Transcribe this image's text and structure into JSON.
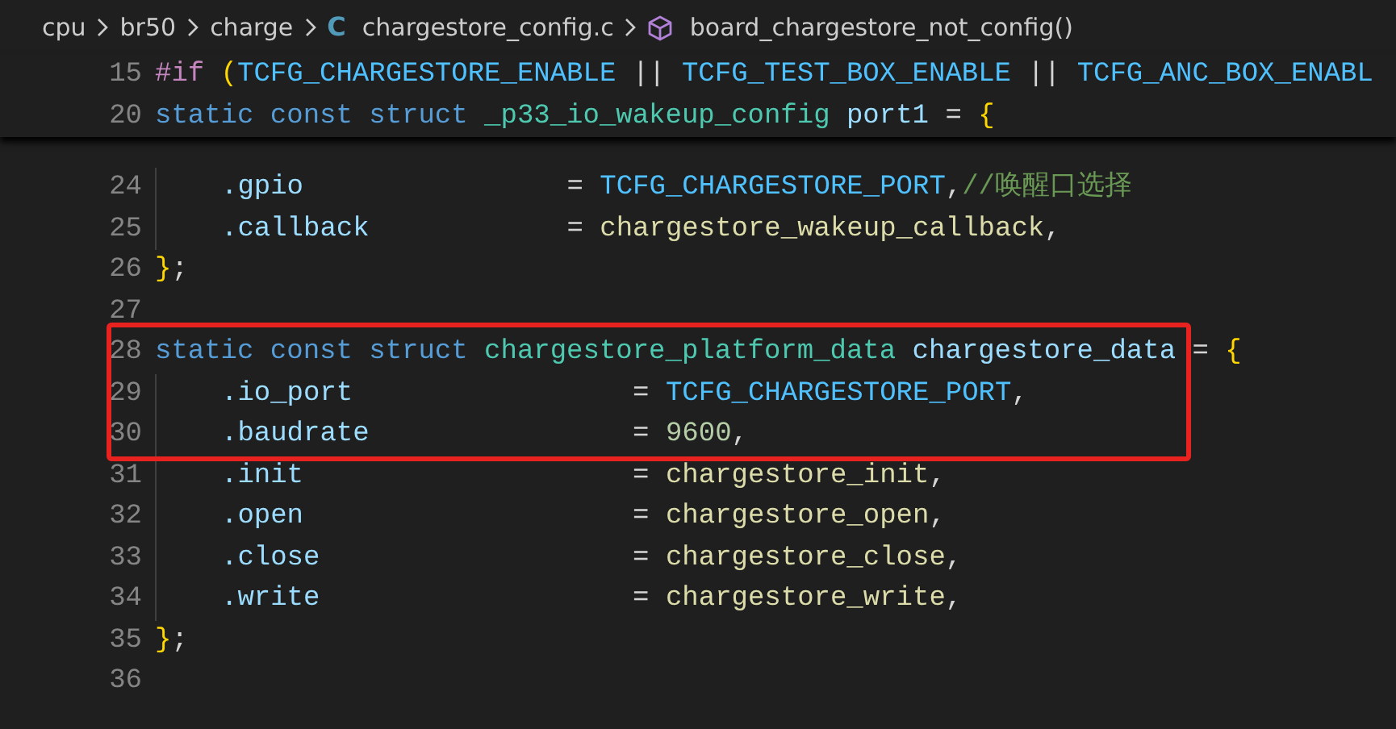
{
  "breadcrumb": [
    {
      "text": "cpu",
      "kind": "folder"
    },
    {
      "text": "br50",
      "kind": "folder"
    },
    {
      "text": "charge",
      "kind": "folder"
    },
    {
      "text": "chargestore_config.c",
      "kind": "file",
      "icon_text": "C"
    },
    {
      "text": "board_chargestore_not_config()",
      "kind": "symbol"
    }
  ],
  "sticky_lines": [
    {
      "number": "15",
      "guide": false,
      "tokens": [
        {
          "t": "#if",
          "kind": "directive"
        },
        {
          "t": " (",
          "kind": "brace"
        },
        {
          "t": "TCFG_CHARGESTORE_ENABLE",
          "kind": "macro"
        },
        {
          "t": " || ",
          "kind": "plain"
        },
        {
          "t": "TCFG_TEST_BOX_ENABLE",
          "kind": "macro"
        },
        {
          "t": " || ",
          "kind": "plain"
        },
        {
          "t": "TCFG_ANC_BOX_ENABL",
          "kind": "macro"
        }
      ]
    },
    {
      "number": "20",
      "guide": false,
      "tokens": [
        {
          "t": "static const struct",
          "kind": "keyword"
        },
        {
          "t": " _p33_io_wakeup_config",
          "kind": "type"
        },
        {
          "t": " port1",
          "kind": "variable"
        },
        {
          "t": " = ",
          "kind": "plain"
        },
        {
          "t": "{",
          "kind": "brace"
        }
      ]
    }
  ],
  "lines": [
    {
      "number": "24",
      "guide": true,
      "boxed": false,
      "tokens": [
        {
          "t": ".gpio",
          "kind": "variable"
        },
        {
          "t": "                = ",
          "kind": "plain"
        },
        {
          "t": "TCFG_CHARGESTORE_PORT",
          "kind": "macro"
        },
        {
          "t": ",",
          "kind": "plain"
        },
        {
          "t": "//唤醒口选择",
          "kind": "comment"
        }
      ]
    },
    {
      "number": "25",
      "guide": true,
      "boxed": false,
      "tokens": [
        {
          "t": ".callback",
          "kind": "variable"
        },
        {
          "t": "            = ",
          "kind": "plain"
        },
        {
          "t": "chargestore_wakeup_callback",
          "kind": "function"
        },
        {
          "t": ",",
          "kind": "plain"
        }
      ]
    },
    {
      "number": "26",
      "guide": false,
      "boxed": false,
      "tokens": [
        {
          "t": "}",
          "kind": "brace"
        },
        {
          "t": ";",
          "kind": "plain"
        }
      ]
    },
    {
      "number": "27",
      "guide": false,
      "boxed": false
    },
    {
      "number": "28",
      "guide": false,
      "boxed": true,
      "tokens": [
        {
          "t": "static const struct",
          "kind": "keyword"
        },
        {
          "t": " chargestore_platform_data",
          "kind": "type"
        },
        {
          "t": " chargestore_data",
          "kind": "variable"
        },
        {
          "t": " = ",
          "kind": "plain"
        },
        {
          "t": "{",
          "kind": "brace"
        }
      ]
    },
    {
      "number": "29",
      "guide": true,
      "boxed": true,
      "tokens": [
        {
          "t": ".io_port",
          "kind": "variable"
        },
        {
          "t": "                 = ",
          "kind": "plain"
        },
        {
          "t": "TCFG_CHARGESTORE_PORT",
          "kind": "macro"
        },
        {
          "t": ",",
          "kind": "plain"
        }
      ]
    },
    {
      "number": "30",
      "guide": true,
      "boxed": true,
      "tokens": [
        {
          "t": ".baudrate",
          "kind": "variable"
        },
        {
          "t": "                = ",
          "kind": "plain"
        },
        {
          "t": "9600",
          "kind": "number"
        },
        {
          "t": ",",
          "kind": "plain"
        }
      ]
    },
    {
      "number": "31",
      "guide": true,
      "boxed": false,
      "tokens": [
        {
          "t": ".init",
          "kind": "variable"
        },
        {
          "t": "                    = ",
          "kind": "plain"
        },
        {
          "t": "chargestore_init",
          "kind": "function"
        },
        {
          "t": ",",
          "kind": "plain"
        }
      ]
    },
    {
      "number": "32",
      "guide": true,
      "boxed": false,
      "tokens": [
        {
          "t": ".open",
          "kind": "variable"
        },
        {
          "t": "                    = ",
          "kind": "plain"
        },
        {
          "t": "chargestore_open",
          "kind": "function"
        },
        {
          "t": ",",
          "kind": "plain"
        }
      ]
    },
    {
      "number": "33",
      "guide": true,
      "boxed": false,
      "tokens": [
        {
          "t": ".close",
          "kind": "variable"
        },
        {
          "t": "                   = ",
          "kind": "plain"
        },
        {
          "t": "chargestore_close",
          "kind": "function"
        },
        {
          "t": ",",
          "kind": "plain"
        }
      ]
    },
    {
      "number": "34",
      "guide": true,
      "boxed": false,
      "tokens": [
        {
          "t": ".write",
          "kind": "variable"
        },
        {
          "t": "                   = ",
          "kind": "plain"
        },
        {
          "t": "chargestore_write",
          "kind": "function"
        },
        {
          "t": ",",
          "kind": "plain"
        }
      ]
    },
    {
      "number": "35",
      "guide": false,
      "boxed": false,
      "tokens": [
        {
          "t": "}",
          "kind": "brace"
        },
        {
          "t": ";",
          "kind": "plain"
        }
      ]
    },
    {
      "number": "36",
      "guide": false,
      "boxed": false
    }
  ]
}
